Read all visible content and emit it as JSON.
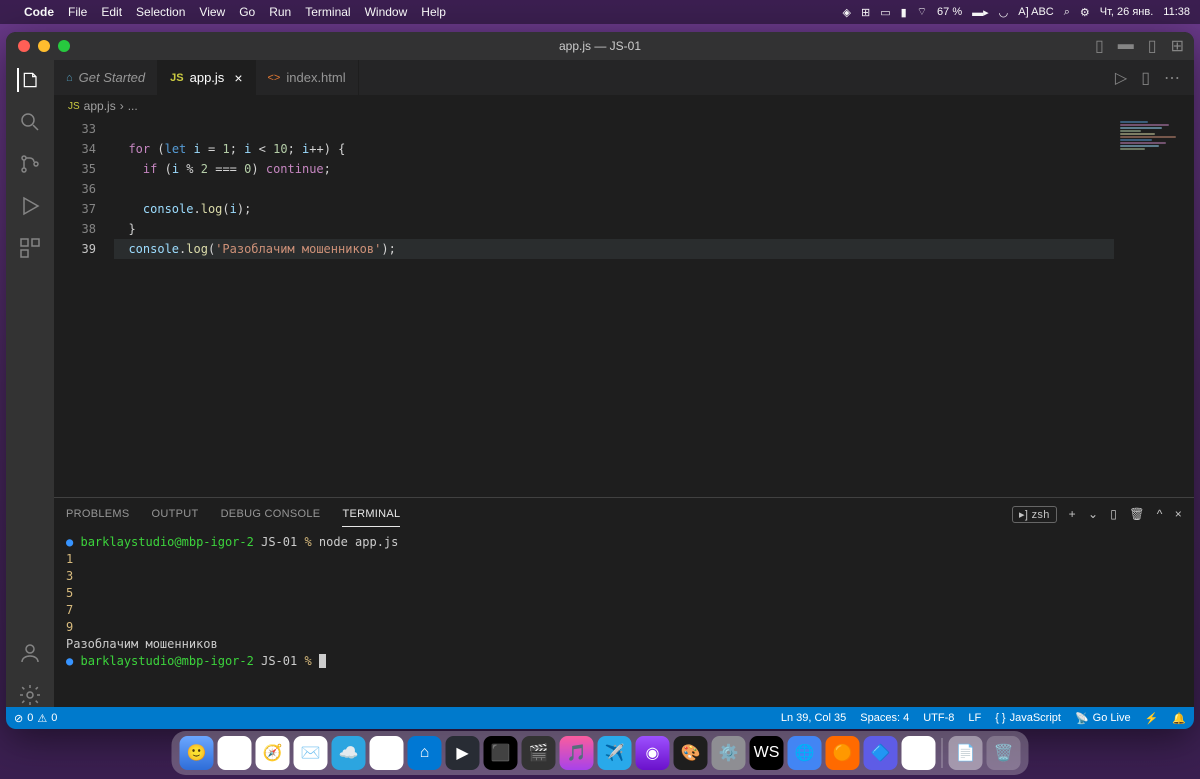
{
  "menubar": {
    "app": "Code",
    "items": [
      "File",
      "Edit",
      "Selection",
      "View",
      "Go",
      "Run",
      "Terminal",
      "Window",
      "Help"
    ],
    "right": {
      "battery": "67 %",
      "input": "A] ABC",
      "date": "Чт, 26 янв.",
      "time": "11:38"
    }
  },
  "titlebar": {
    "title": "app.js — JS-01"
  },
  "tabs": [
    {
      "icon": "vscode",
      "label": "Get Started",
      "active": false
    },
    {
      "icon": "JS",
      "label": "app.js",
      "active": true,
      "closable": true
    },
    {
      "icon": "<>",
      "label": "index.html",
      "active": false
    }
  ],
  "breadcrumb": {
    "icon": "JS",
    "file": "app.js",
    "sep": "›",
    "rest": "..."
  },
  "code": {
    "lines": [
      {
        "n": "33",
        "html": ""
      },
      {
        "n": "34",
        "html": "  <span class='kw-purple'>for</span> <span class='punct'>(</span><span class='kw-blue'>let</span> <span class='var'>i</span> <span class='punct'>=</span> <span class='num'>1</span><span class='punct'>;</span> <span class='var'>i</span> <span class='punct'>&lt;</span> <span class='num'>10</span><span class='punct'>;</span> <span class='var'>i</span><span class='punct'>++) {</span>"
      },
      {
        "n": "35",
        "html": "    <span class='kw-purple'>if</span> <span class='punct'>(</span><span class='var'>i</span> <span class='punct'>%</span> <span class='num'>2</span> <span class='punct'>===</span> <span class='num'>0</span><span class='punct'>)</span> <span class='kw-purple'>continue</span><span class='punct'>;</span>"
      },
      {
        "n": "36",
        "html": ""
      },
      {
        "n": "37",
        "html": "    <span class='var'>console</span><span class='punct'>.</span><span class='fn'>log</span><span class='punct'>(</span><span class='var'>i</span><span class='punct'>);</span>"
      },
      {
        "n": "38",
        "html": "  <span class='punct'>}</span>"
      },
      {
        "n": "39",
        "html": "  <span class='var'>console</span><span class='punct'>.</span><span class='fn'>log</span><span class='punct'>(</span><span class='str'>'Разоблачим мошенников'</span><span class='punct'>);</span>",
        "current": true
      }
    ]
  },
  "panel": {
    "tabs": [
      "PROBLEMS",
      "OUTPUT",
      "DEBUG CONSOLE",
      "TERMINAL"
    ],
    "active": "TERMINAL",
    "shell": "zsh",
    "terminal": [
      {
        "type": "prompt",
        "user": "barklaystudio@mbp-igor-2",
        "path": "JS-01",
        "cmd": "node app.js"
      },
      {
        "type": "out",
        "text": "1"
      },
      {
        "type": "out",
        "text": "3"
      },
      {
        "type": "out",
        "text": "5"
      },
      {
        "type": "out",
        "text": "7"
      },
      {
        "type": "out",
        "text": "9"
      },
      {
        "type": "out",
        "text": "Разоблачим мошенников",
        "plain": true
      },
      {
        "type": "prompt",
        "user": "barklaystudio@mbp-igor-2",
        "path": "JS-01",
        "cmd": ""
      }
    ]
  },
  "status": {
    "errors": "0",
    "warnings": "0",
    "cursor": "Ln 39, Col 35",
    "spaces": "Spaces: 4",
    "encoding": "UTF-8",
    "eol": "LF",
    "lang": "JavaScript",
    "golive": "Go Live"
  }
}
